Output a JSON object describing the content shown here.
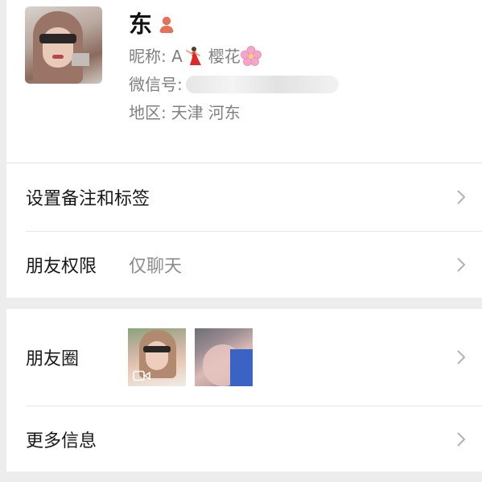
{
  "profile": {
    "name": "东",
    "nickname_prefix": "昵称: A",
    "nickname_suffix": "樱花",
    "wechat_label": "微信号:",
    "region_label": "地区:",
    "region_city": "天津",
    "region_district": "河东"
  },
  "rows": {
    "remark": {
      "label": "设置备注和标签"
    },
    "permissions": {
      "label": "朋友权限",
      "value": "仅聊天"
    },
    "moments": {
      "label": "朋友圈"
    },
    "more": {
      "label": "更多信息"
    }
  },
  "icons": {
    "gender": "female-icon",
    "dancer_emoji": "dancer-emoji-icon",
    "blossom_emoji": "cherry-blossom-emoji-icon",
    "chevron": "chevron-right-icon",
    "video": "video-icon"
  },
  "colors": {
    "background": "#ededed",
    "card": "#ffffff",
    "primary_text": "#191919",
    "secondary_text": "#808080",
    "gender_accent": "#e2725b"
  }
}
